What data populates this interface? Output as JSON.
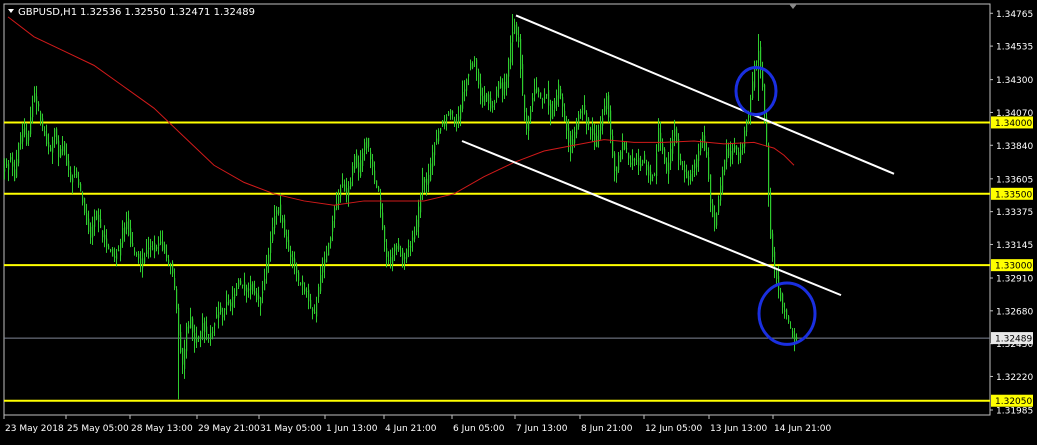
{
  "header": {
    "symbol": "GBPUSD,H1",
    "ohlc": "1.32536 1.32550 1.32471 1.32489"
  },
  "colors": {
    "background": "#000000",
    "frame": "#c0c0c0",
    "candle": "#2ecc2e",
    "moving_average": "#d11a1a",
    "level_line": "#ffff00",
    "channel_line": "#ffffff",
    "ellipse": "#1a2fe0",
    "current_price": "#7f8696",
    "label_text": "#ffffff",
    "level_label_bg": "#ffff00",
    "level_label_text": "#000000",
    "price_label_bg": "#e8e8e8"
  },
  "chart_data": {
    "type": "candlestick",
    "symbol": "GBPUSD",
    "timeframe": "H1",
    "ylim": [
      1.3195,
      1.3483
    ],
    "y_ticks": [
      "1.34765",
      "1.34535",
      "1.34300",
      "1.34070",
      "1.33840",
      "1.33605",
      "1.33375",
      "1.33145",
      "1.32910",
      "1.32680",
      "1.32450",
      "1.32220",
      "1.31985"
    ],
    "x_ticks": [
      "23 May 2018",
      "25 May 05:00",
      "28 May 13:00",
      "29 May 21:00",
      "31 May 05:00",
      "1 Jun 13:00",
      "4 Jun 21:00",
      "6 Jun 05:00",
      "7 Jun 13:00",
      "8 Jun 21:00",
      "12 Jun 05:00",
      "13 Jun 13:00",
      "14 Jun 21:00"
    ],
    "horizontal_levels": [
      {
        "value": 1.34,
        "label": "1.34000"
      },
      {
        "value": 1.335,
        "label": "1.33500"
      },
      {
        "value": 1.33,
        "label": "1.33000"
      },
      {
        "value": 1.3205,
        "label": "1.32050"
      }
    ],
    "current_price": {
      "value": 1.32489,
      "label": "1.32489"
    },
    "price_path": [
      [
        0,
        1.3365
      ],
      [
        4,
        1.337
      ],
      [
        8,
        1.3375
      ],
      [
        12,
        1.336
      ],
      [
        16,
        1.3385
      ],
      [
        20,
        1.3395
      ],
      [
        24,
        1.3385
      ],
      [
        28,
        1.3405
      ],
      [
        32,
        1.342
      ],
      [
        36,
        1.341
      ],
      [
        40,
        1.3395
      ],
      [
        44,
        1.3385
      ],
      [
        48,
        1.338
      ],
      [
        52,
        1.3395
      ],
      [
        56,
        1.3375
      ],
      [
        60,
        1.3385
      ],
      [
        64,
        1.337
      ],
      [
        68,
        1.336
      ],
      [
        72,
        1.3365
      ],
      [
        76,
        1.3355
      ],
      [
        80,
        1.3345
      ],
      [
        84,
        1.333
      ],
      [
        88,
        1.332
      ],
      [
        92,
        1.3335
      ],
      [
        96,
        1.333
      ],
      [
        100,
        1.332
      ],
      [
        104,
        1.3315
      ],
      [
        108,
        1.331
      ],
      [
        112,
        1.3305
      ],
      [
        116,
        1.331
      ],
      [
        120,
        1.3325
      ],
      [
        124,
        1.333
      ],
      [
        128,
        1.3315
      ],
      [
        132,
        1.331
      ],
      [
        136,
        1.3305
      ],
      [
        140,
        1.33
      ],
      [
        144,
        1.331
      ],
      [
        148,
        1.3315
      ],
      [
        152,
        1.331
      ],
      [
        156,
        1.3315
      ],
      [
        160,
        1.3312
      ],
      [
        164,
        1.3305
      ],
      [
        168,
        1.33
      ],
      [
        172,
        1.3285
      ],
      [
        176,
        1.325
      ],
      [
        180,
        1.323
      ],
      [
        184,
        1.3255
      ],
      [
        188,
        1.3262
      ],
      [
        192,
        1.3245
      ],
      [
        196,
        1.325
      ],
      [
        200,
        1.3258
      ],
      [
        204,
        1.3252
      ],
      [
        208,
        1.325
      ],
      [
        212,
        1.326
      ],
      [
        216,
        1.3268
      ],
      [
        220,
        1.3265
      ],
      [
        224,
        1.3275
      ],
      [
        228,
        1.3272
      ],
      [
        232,
        1.328
      ],
      [
        236,
        1.329
      ],
      [
        240,
        1.3285
      ],
      [
        244,
        1.328
      ],
      [
        248,
        1.3285
      ],
      [
        252,
        1.328
      ],
      [
        256,
        1.3275
      ],
      [
        260,
        1.3282
      ],
      [
        264,
        1.33
      ],
      [
        268,
        1.3315
      ],
      [
        272,
        1.3335
      ],
      [
        276,
        1.334
      ],
      [
        280,
        1.333
      ],
      [
        284,
        1.3315
      ],
      [
        288,
        1.3305
      ],
      [
        292,
        1.33
      ],
      [
        296,
        1.329
      ],
      [
        300,
        1.3285
      ],
      [
        304,
        1.328
      ],
      [
        308,
        1.327
      ],
      [
        312,
        1.3265
      ],
      [
        316,
        1.3285
      ],
      [
        320,
        1.33
      ],
      [
        324,
        1.331
      ],
      [
        328,
        1.332
      ],
      [
        332,
        1.334
      ],
      [
        336,
        1.335
      ],
      [
        340,
        1.3355
      ],
      [
        344,
        1.335
      ],
      [
        348,
        1.336
      ],
      [
        352,
        1.3375
      ],
      [
        356,
        1.3365
      ],
      [
        360,
        1.338
      ],
      [
        364,
        1.339
      ],
      [
        368,
        1.3375
      ],
      [
        372,
        1.336
      ],
      [
        376,
        1.335
      ],
      [
        380,
        1.3325
      ],
      [
        384,
        1.3305
      ],
      [
        388,
        1.33
      ],
      [
        392,
        1.3315
      ],
      [
        396,
        1.331
      ],
      [
        400,
        1.3305
      ],
      [
        404,
        1.331
      ],
      [
        408,
        1.3315
      ],
      [
        412,
        1.332
      ],
      [
        416,
        1.334
      ],
      [
        420,
        1.336
      ],
      [
        424,
        1.3355
      ],
      [
        428,
        1.337
      ],
      [
        432,
        1.3385
      ],
      [
        436,
        1.3395
      ],
      [
        440,
        1.34
      ],
      [
        444,
        1.3405
      ],
      [
        448,
        1.341
      ],
      [
        452,
        1.34
      ],
      [
        456,
        1.3405
      ],
      [
        460,
        1.342
      ],
      [
        464,
        1.343
      ],
      [
        468,
        1.344
      ],
      [
        472,
        1.3445
      ],
      [
        476,
        1.3425
      ],
      [
        480,
        1.3415
      ],
      [
        484,
        1.342
      ],
      [
        488,
        1.341
      ],
      [
        492,
        1.3415
      ],
      [
        496,
        1.343
      ],
      [
        500,
        1.342
      ],
      [
        504,
        1.3435
      ],
      [
        508,
        1.3455
      ],
      [
        512,
        1.347
      ],
      [
        516,
        1.3455
      ],
      [
        520,
        1.342
      ],
      [
        524,
        1.3395
      ],
      [
        528,
        1.341
      ],
      [
        532,
        1.3425
      ],
      [
        536,
        1.342
      ],
      [
        540,
        1.3415
      ],
      [
        544,
        1.342
      ],
      [
        548,
        1.3405
      ],
      [
        552,
        1.3415
      ],
      [
        556,
        1.3425
      ],
      [
        560,
        1.341
      ],
      [
        564,
        1.3395
      ],
      [
        568,
        1.338
      ],
      [
        572,
        1.3395
      ],
      [
        576,
        1.3405
      ],
      [
        580,
        1.341
      ],
      [
        584,
        1.34
      ],
      [
        588,
        1.3395
      ],
      [
        592,
        1.3385
      ],
      [
        596,
        1.3395
      ],
      [
        600,
        1.3405
      ],
      [
        604,
        1.342
      ],
      [
        608,
        1.339
      ],
      [
        612,
        1.3365
      ],
      [
        616,
        1.3375
      ],
      [
        620,
        1.3385
      ],
      [
        624,
        1.338
      ],
      [
        628,
        1.337
      ],
      [
        632,
        1.3375
      ],
      [
        636,
        1.337
      ],
      [
        640,
        1.3375
      ],
      [
        644,
        1.3368
      ],
      [
        648,
        1.336
      ],
      [
        652,
        1.3365
      ],
      [
        656,
        1.3395
      ],
      [
        660,
        1.338
      ],
      [
        664,
        1.3365
      ],
      [
        668,
        1.338
      ],
      [
        672,
        1.3395
      ],
      [
        676,
        1.3375
      ],
      [
        680,
        1.337
      ],
      [
        684,
        1.336
      ],
      [
        688,
        1.3365
      ],
      [
        692,
        1.337
      ],
      [
        696,
        1.338
      ],
      [
        700,
        1.339
      ],
      [
        704,
        1.3375
      ],
      [
        708,
        1.3345
      ],
      [
        712,
        1.3325
      ],
      [
        716,
        1.3345
      ],
      [
        720,
        1.3365
      ],
      [
        724,
        1.338
      ],
      [
        728,
        1.3375
      ],
      [
        732,
        1.3385
      ],
      [
        736,
        1.3375
      ],
      [
        740,
        1.3385
      ],
      [
        744,
        1.34
      ],
      [
        748,
        1.3415
      ],
      [
        752,
        1.344
      ],
      [
        756,
        1.345
      ],
      [
        760,
        1.3425
      ],
      [
        764,
        1.3385
      ],
      [
        766,
        1.335
      ],
      [
        768,
        1.332
      ],
      [
        771,
        1.33
      ],
      [
        774,
        1.329
      ],
      [
        777,
        1.328
      ],
      [
        780,
        1.327
      ],
      [
        783,
        1.3265
      ],
      [
        786,
        1.326
      ],
      [
        789,
        1.3252
      ],
      [
        792,
        1.3249
      ]
    ],
    "moving_average": [
      [
        4,
        1.3474
      ],
      [
        30,
        1.346
      ],
      [
        60,
        1.345
      ],
      [
        90,
        1.344
      ],
      [
        120,
        1.3425
      ],
      [
        150,
        1.341
      ],
      [
        180,
        1.339
      ],
      [
        210,
        1.337
      ],
      [
        240,
        1.3358
      ],
      [
        270,
        1.335
      ],
      [
        300,
        1.3345
      ],
      [
        330,
        1.3342
      ],
      [
        360,
        1.3345
      ],
      [
        390,
        1.3345
      ],
      [
        420,
        1.3345
      ],
      [
        450,
        1.335
      ],
      [
        480,
        1.3362
      ],
      [
        510,
        1.3372
      ],
      [
        540,
        1.338
      ],
      [
        570,
        1.3384
      ],
      [
        600,
        1.3388
      ],
      [
        630,
        1.3386
      ],
      [
        660,
        1.3386
      ],
      [
        690,
        1.3387
      ],
      [
        720,
        1.3385
      ],
      [
        750,
        1.3386
      ],
      [
        770,
        1.3382
      ],
      [
        780,
        1.3377
      ],
      [
        790,
        1.337
      ]
    ],
    "channel_lines": [
      {
        "from": [
          512,
          1.3475
        ],
        "to": [
          890,
          1.3364
        ]
      },
      {
        "from": [
          458,
          1.3387
        ],
        "to": [
          837,
          1.3279
        ]
      }
    ],
    "ellipses": [
      {
        "x": 752,
        "y": 1.3422,
        "rx": 20,
        "ry": 0.00165
      },
      {
        "x": 783,
        "y": 1.3266,
        "rx": 28,
        "ry": 0.00215
      }
    ]
  }
}
